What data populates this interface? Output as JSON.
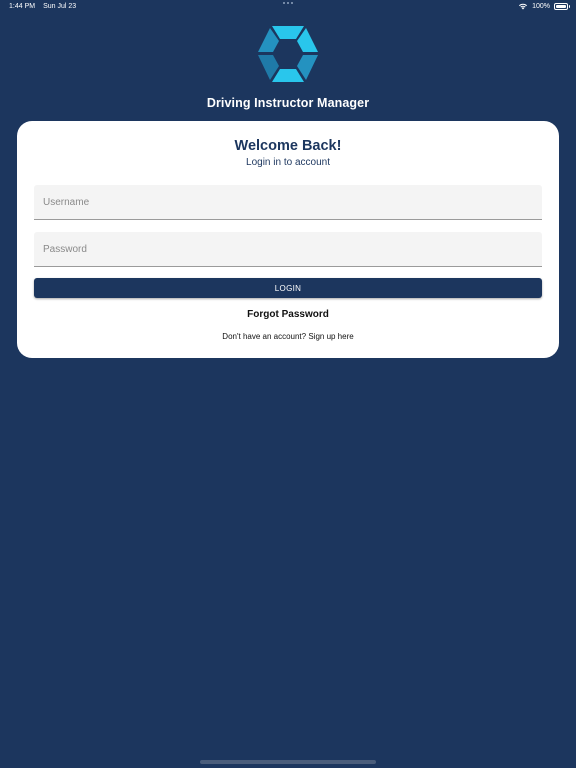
{
  "status_bar": {
    "time": "1:44 PM",
    "date": "Sun Jul 23",
    "battery": "100%",
    "battery_level": 1.0,
    "wifi_icon": "wifi-icon"
  },
  "app": {
    "name": "Driving Instructor Manager",
    "logo_icon": "hexagon-logo-icon",
    "logo_colors": [
      "#29c6ec",
      "#2492c0",
      "#1f7aa8"
    ]
  },
  "login_card": {
    "title": "Welcome Back!",
    "subtitle": "Login in to account",
    "username_placeholder": "Username",
    "username_value": "",
    "password_placeholder": "Password",
    "password_value": "",
    "login_label": "LOGIN",
    "forgot_password_label": "Forgot Password",
    "signup_prompt": "Don't have an account? Sign up here"
  },
  "colors": {
    "background": "#1c365e",
    "card": "#ffffff",
    "accent": "#1c365e",
    "field_background": "#f4f4f4"
  }
}
